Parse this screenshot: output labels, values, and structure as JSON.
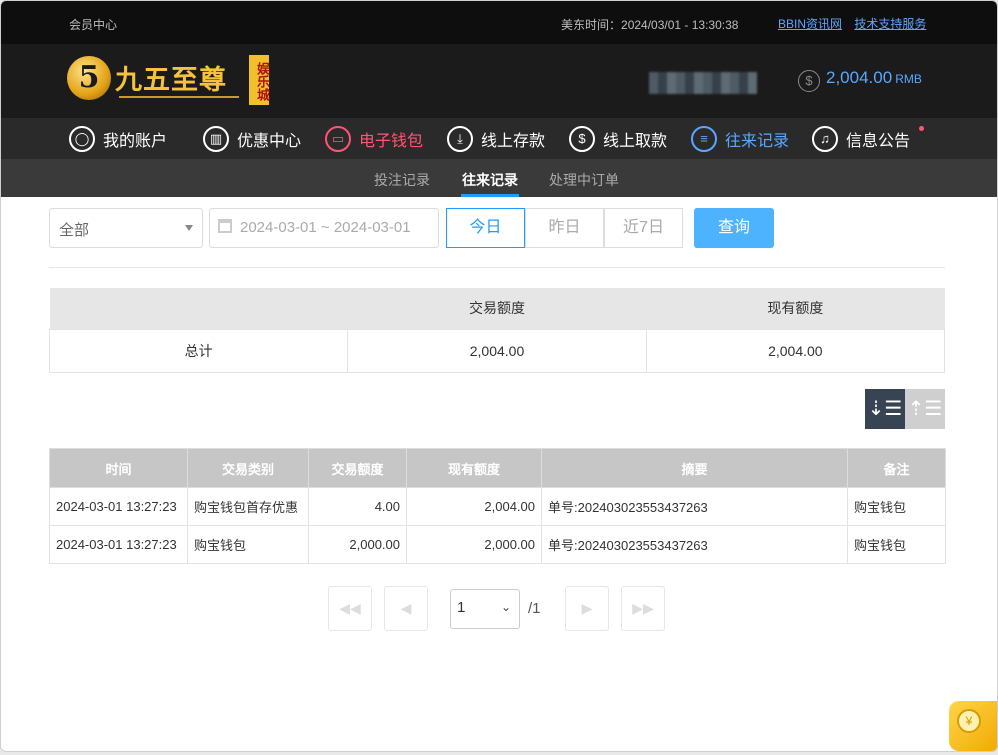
{
  "topbar": {
    "member_center": "会员中心",
    "time_label": "美东时间：",
    "time_value": "2024/03/01 - 13:30:38",
    "link_news": "BBIN资讯网",
    "link_support": "技术支持服务"
  },
  "header": {
    "logo_text": "九五至尊",
    "logo_badge": "娱乐城",
    "logo_numeral": "5",
    "balance_symbol": "$",
    "balance": "2,004.00",
    "balance_unit": "RMB"
  },
  "nav": {
    "items": [
      {
        "label": "我的账户",
        "icon": "user-icon",
        "glyph": "◯"
      },
      {
        "label": "优惠中心",
        "icon": "gift-icon",
        "glyph": "▥"
      },
      {
        "label": "电子钱包",
        "icon": "wallet-icon",
        "glyph": "▭"
      },
      {
        "label": "线上存款",
        "icon": "deposit-icon",
        "glyph": "⤓"
      },
      {
        "label": "线上取款",
        "icon": "withdraw-icon",
        "glyph": "$"
      },
      {
        "label": "往来记录",
        "icon": "record-icon",
        "glyph": "≡"
      },
      {
        "label": "信息公告",
        "icon": "bell-icon",
        "glyph": "♫"
      }
    ],
    "accent_pink": "#ff5573",
    "accent_blue": "#5aa7ff"
  },
  "subnav": {
    "tabs": [
      "投注记录",
      "往来记录",
      "处理中订单"
    ],
    "active": "往来记录"
  },
  "filters": {
    "type_selected": "全部",
    "date_range": "2024-03-01 ~ 2024-03-01",
    "quick": [
      "今日",
      "昨日",
      "近7日"
    ],
    "quick_active": "今日",
    "query": "查询"
  },
  "summary": {
    "headers": [
      "",
      "交易额度",
      "现有额度"
    ],
    "row": [
      "总计",
      "2,004.00",
      "2,004.00"
    ]
  },
  "detail": {
    "headers": [
      "时间",
      "交易类别",
      "交易额度",
      "现有额度",
      "摘要",
      "备注"
    ],
    "rows": [
      [
        "2024-03-01 13:27:23",
        "购宝钱包首存优惠",
        "4.00",
        "2,004.00",
        "单号:202403023553437263",
        "购宝钱包"
      ],
      [
        "2024-03-01 13:27:23",
        "购宝钱包",
        "2,000.00",
        "2,000.00",
        "单号:202403023553437263",
        "购宝钱包"
      ]
    ]
  },
  "pager": {
    "page": "1",
    "total": "/1"
  },
  "colors": {
    "primary_blue": "#1e9bff",
    "query_button": "#4db3ff"
  }
}
